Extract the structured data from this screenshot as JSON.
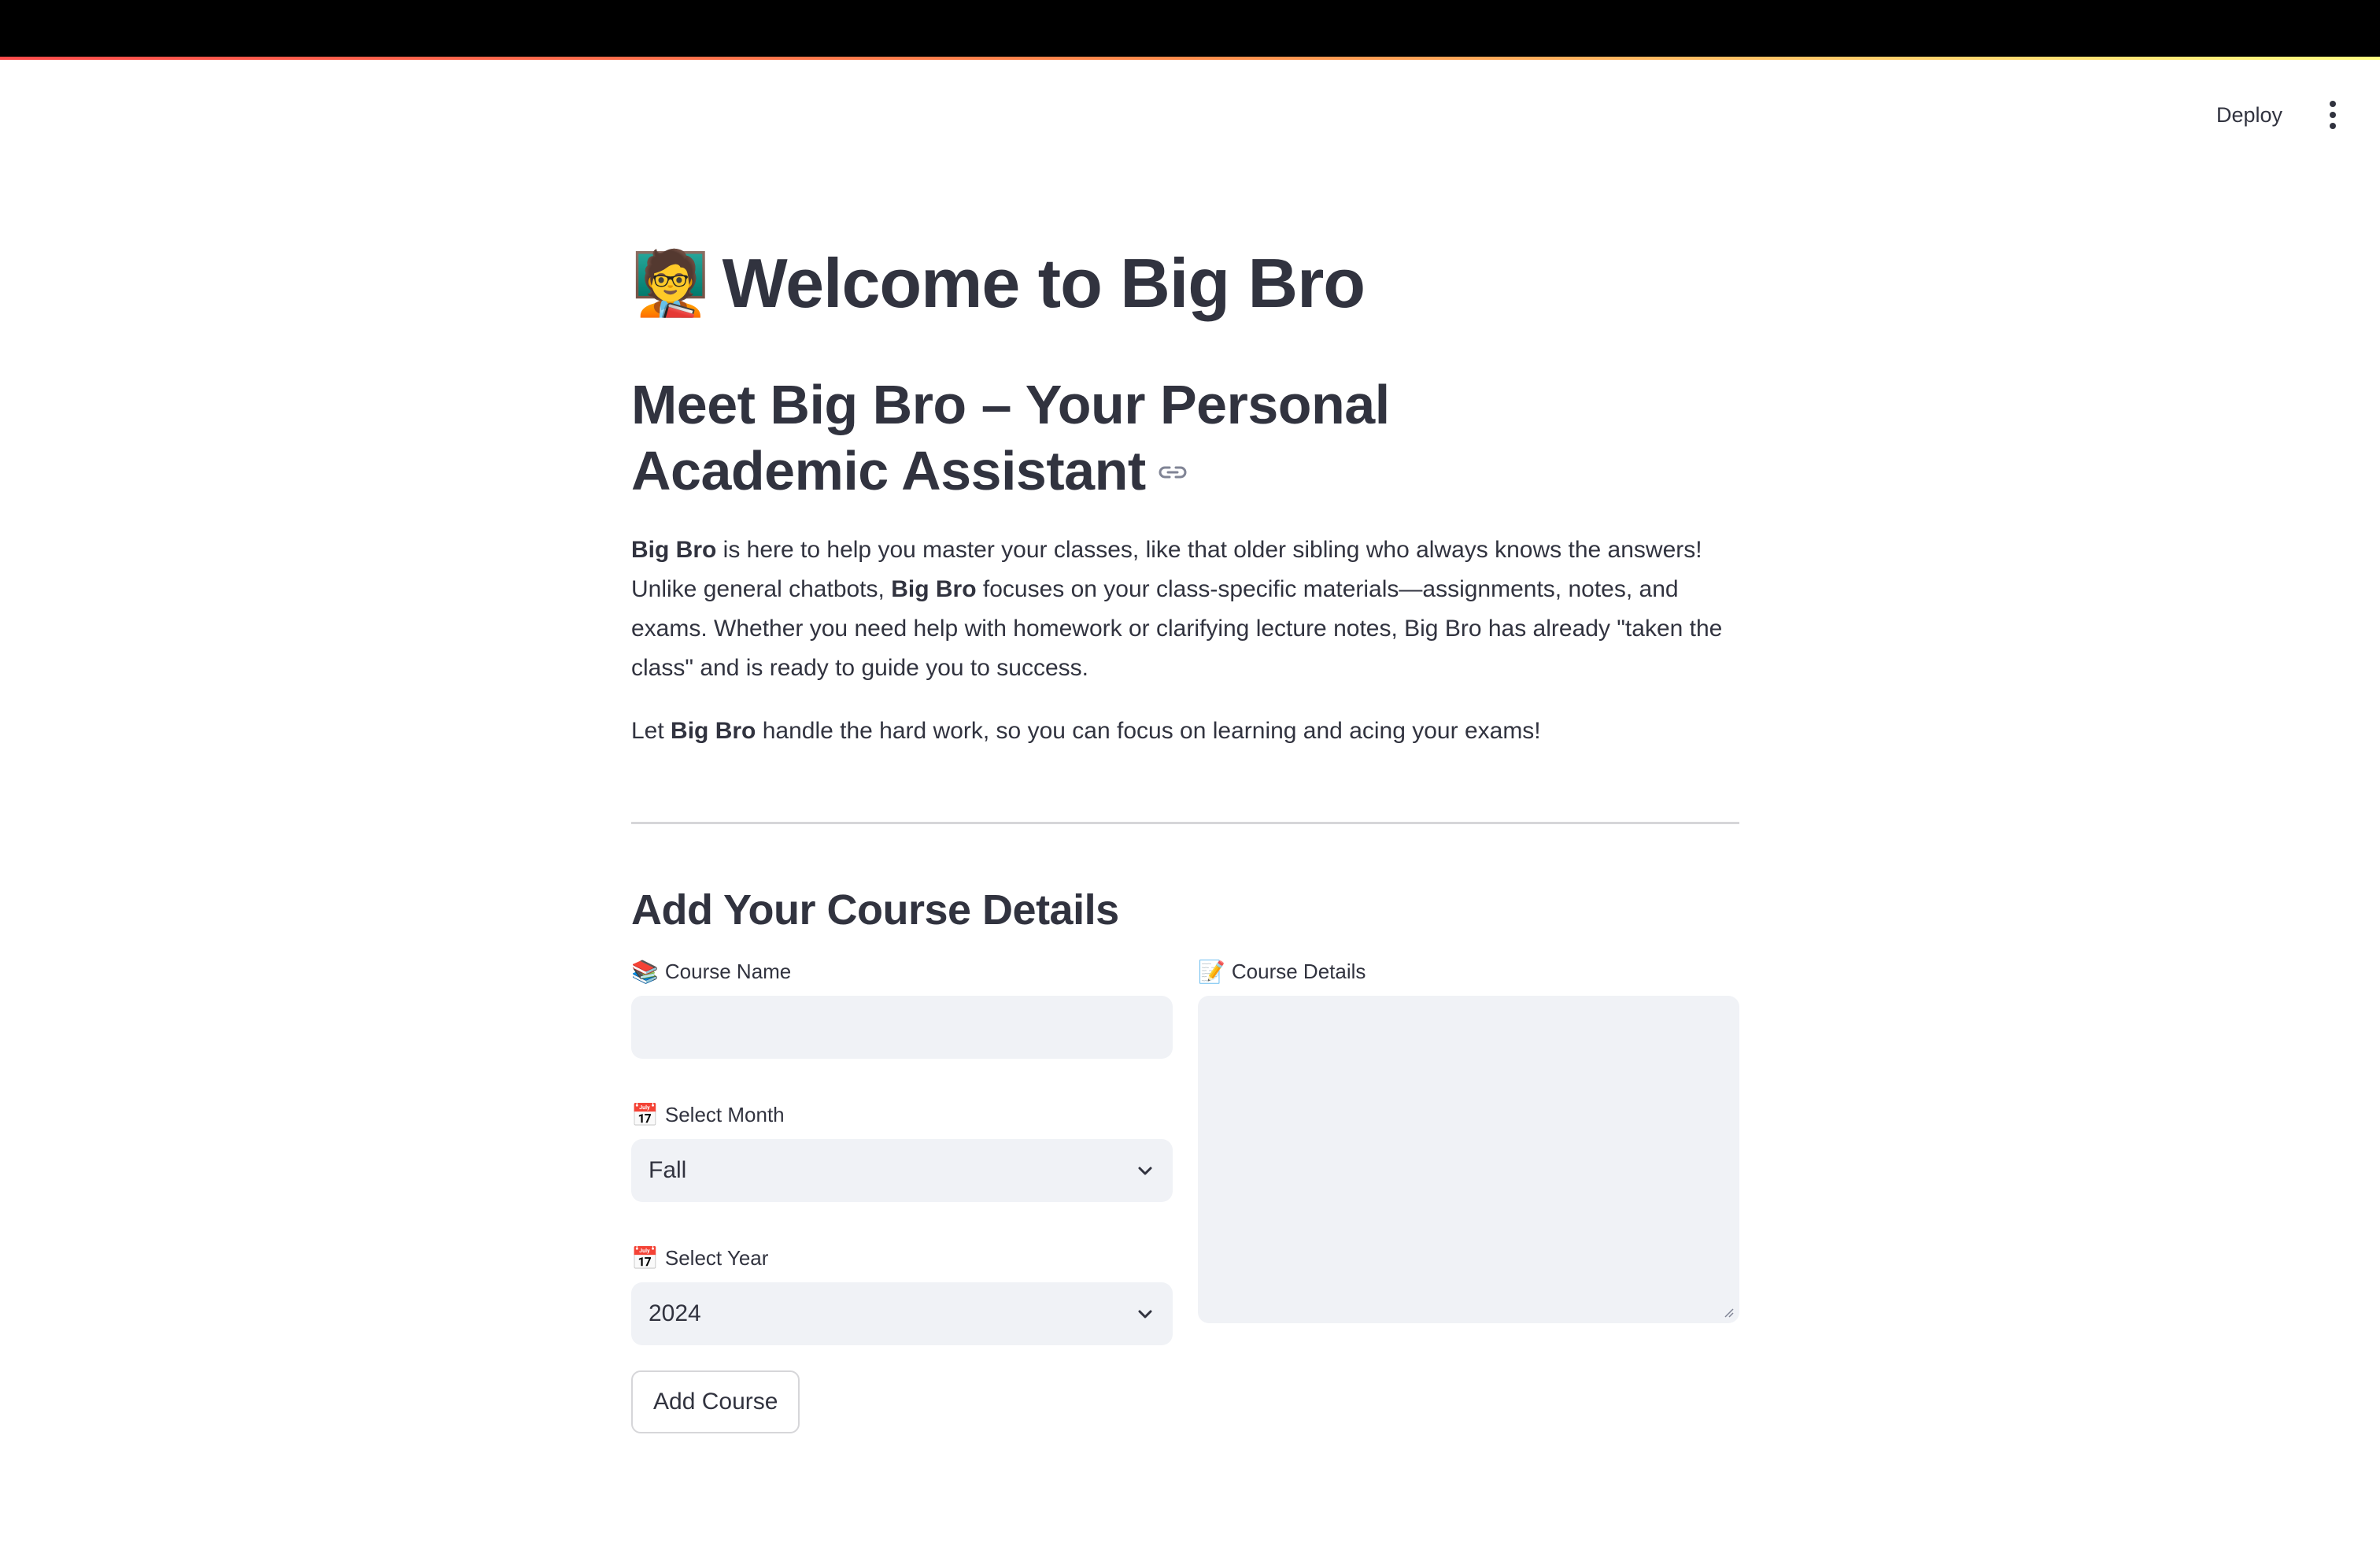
{
  "header": {
    "deploy_label": "Deploy",
    "menu_icon": "kebab-menu-icon"
  },
  "hero": {
    "title_emoji": "🧑‍🏫",
    "title": "Welcome to Big Bro",
    "subtitle": "Meet Big Bro – Your Personal Academic Assistant",
    "anchor_icon": "link-icon"
  },
  "intro": {
    "p1_bold1": "Big Bro",
    "p1_text1": " is here to help you master your classes, like that older sibling who always knows the answers! Unlike general chatbots, ",
    "p1_bold2": "Big Bro",
    "p1_text2": " focuses on your class-specific materials—assignments, notes, and exams. Whether you need help with homework or clarifying lecture notes, Big Bro has already \"taken the class\" and is ready to guide you to success.",
    "p2_text1": "Let ",
    "p2_bold": "Big Bro",
    "p2_text2": " handle the hard work, so you can focus on learning and acing your exams!"
  },
  "form": {
    "section_title": "Add Your Course Details",
    "course_name": {
      "emoji": "📚",
      "label": "Course Name",
      "value": "",
      "placeholder": ""
    },
    "month": {
      "emoji": "📅",
      "label": "Select Month",
      "selected": "Fall"
    },
    "year": {
      "emoji": "📅",
      "label": "Select Year",
      "selected": "2024"
    },
    "course_details": {
      "emoji": "📝",
      "label": "Course Details",
      "value": "",
      "placeholder": ""
    },
    "add_button_label": "Add Course"
  }
}
